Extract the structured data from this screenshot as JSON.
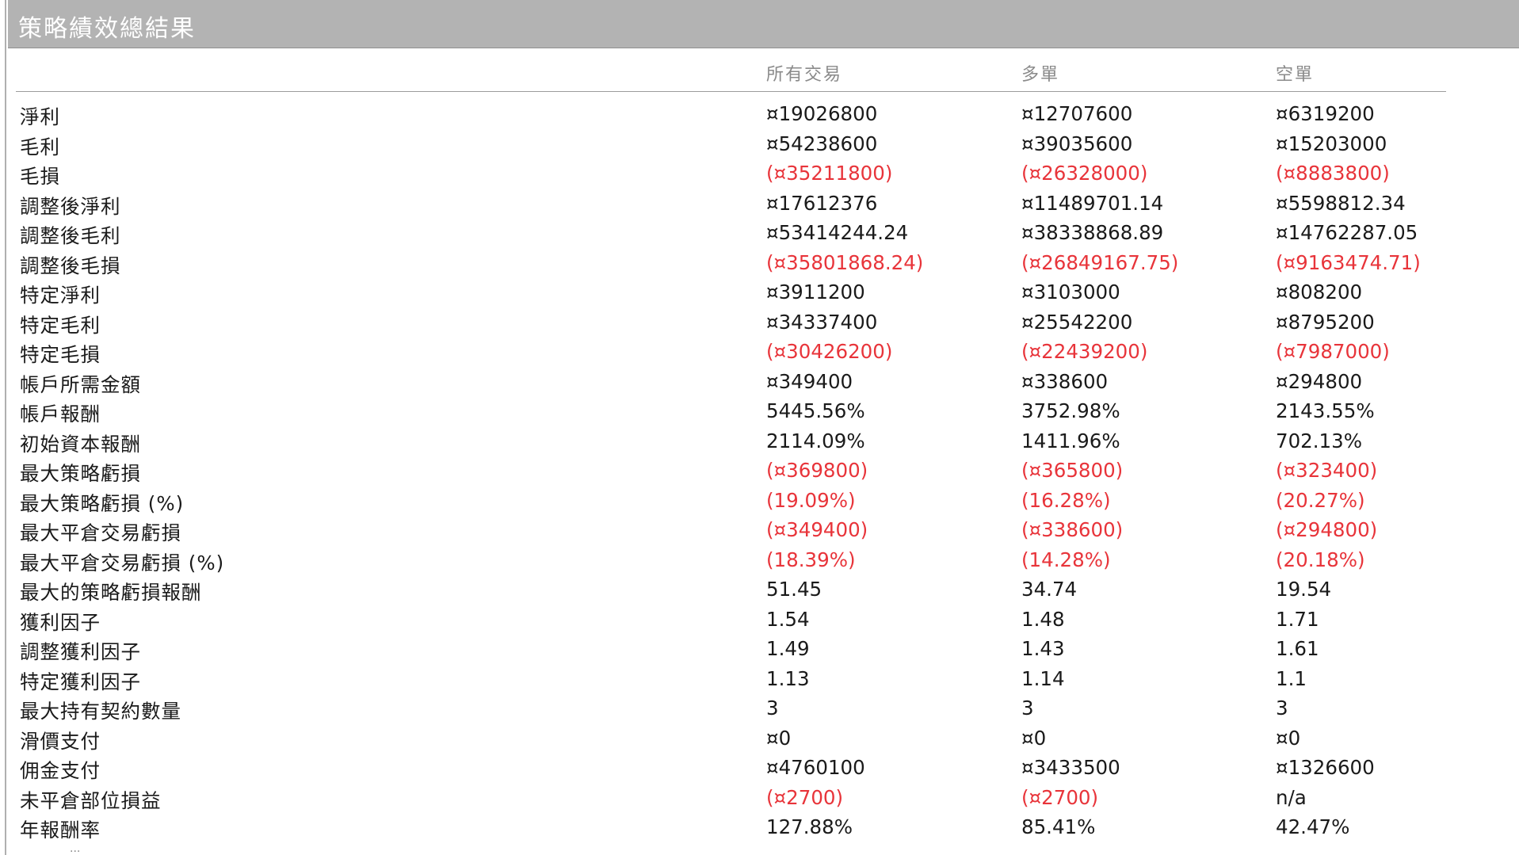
{
  "title": "策略績效總結果",
  "columns": [
    "所有交易",
    "多單",
    "空單"
  ],
  "colors": {
    "negative": "#e8343a",
    "header_bar": "#b3b3b3",
    "text": "#1a1a1a"
  },
  "rows": [
    {
      "label": "淨利",
      "values": [
        "¤19026800",
        "¤12707600",
        "¤6319200"
      ],
      "neg": [
        false,
        false,
        false
      ]
    },
    {
      "label": "毛利",
      "values": [
        "¤54238600",
        "¤39035600",
        "¤15203000"
      ],
      "neg": [
        false,
        false,
        false
      ]
    },
    {
      "label": "毛損",
      "values": [
        "(¤35211800)",
        "(¤26328000)",
        "(¤8883800)"
      ],
      "neg": [
        true,
        true,
        true
      ]
    },
    {
      "label": "調整後淨利",
      "values": [
        "¤17612376",
        "¤11489701.14",
        "¤5598812.34"
      ],
      "neg": [
        false,
        false,
        false
      ]
    },
    {
      "label": "調整後毛利",
      "values": [
        "¤53414244.24",
        "¤38338868.89",
        "¤14762287.05"
      ],
      "neg": [
        false,
        false,
        false
      ]
    },
    {
      "label": "調整後毛損",
      "values": [
        "(¤35801868.24)",
        "(¤26849167.75)",
        "(¤9163474.71)"
      ],
      "neg": [
        true,
        true,
        true
      ]
    },
    {
      "label": "特定淨利",
      "values": [
        "¤3911200",
        "¤3103000",
        "¤808200"
      ],
      "neg": [
        false,
        false,
        false
      ]
    },
    {
      "label": "特定毛利",
      "values": [
        "¤34337400",
        "¤25542200",
        "¤8795200"
      ],
      "neg": [
        false,
        false,
        false
      ]
    },
    {
      "label": "特定毛損",
      "values": [
        "(¤30426200)",
        "(¤22439200)",
        "(¤7987000)"
      ],
      "neg": [
        true,
        true,
        true
      ]
    },
    {
      "label": "帳戶所需金額",
      "values": [
        "¤349400",
        "¤338600",
        "¤294800"
      ],
      "neg": [
        false,
        false,
        false
      ]
    },
    {
      "label": "帳戶報酬",
      "values": [
        "5445.56%",
        "3752.98%",
        "2143.55%"
      ],
      "neg": [
        false,
        false,
        false
      ]
    },
    {
      "label": "初始資本報酬",
      "values": [
        "2114.09%",
        "1411.96%",
        "702.13%"
      ],
      "neg": [
        false,
        false,
        false
      ]
    },
    {
      "label": "最大策略虧損",
      "values": [
        "(¤369800)",
        "(¤365800)",
        "(¤323400)"
      ],
      "neg": [
        true,
        true,
        true
      ]
    },
    {
      "label": "最大策略虧損 (%)",
      "values": [
        "(19.09%)",
        "(16.28%)",
        "(20.27%)"
      ],
      "neg": [
        true,
        true,
        true
      ]
    },
    {
      "label": "最大平倉交易虧損",
      "values": [
        "(¤349400)",
        "(¤338600)",
        "(¤294800)"
      ],
      "neg": [
        true,
        true,
        true
      ]
    },
    {
      "label": "最大平倉交易虧損 (%)",
      "values": [
        "(18.39%)",
        "(14.28%)",
        "(20.18%)"
      ],
      "neg": [
        true,
        true,
        true
      ]
    },
    {
      "label": "最大的策略虧損報酬",
      "values": [
        "51.45",
        "34.74",
        "19.54"
      ],
      "neg": [
        false,
        false,
        false
      ]
    },
    {
      "label": "獲利因子",
      "values": [
        "1.54",
        "1.48",
        "1.71"
      ],
      "neg": [
        false,
        false,
        false
      ]
    },
    {
      "label": "調整獲利因子",
      "values": [
        "1.49",
        "1.43",
        "1.61"
      ],
      "neg": [
        false,
        false,
        false
      ]
    },
    {
      "label": "特定獲利因子",
      "values": [
        "1.13",
        "1.14",
        "1.1"
      ],
      "neg": [
        false,
        false,
        false
      ]
    },
    {
      "label": "最大持有契約數量",
      "values": [
        "3",
        "3",
        "3"
      ],
      "neg": [
        false,
        false,
        false
      ]
    },
    {
      "label": "滑價支付",
      "values": [
        "¤0",
        "¤0",
        "¤0"
      ],
      "neg": [
        false,
        false,
        false
      ]
    },
    {
      "label": "佣金支付",
      "values": [
        "¤4760100",
        "¤3433500",
        "¤1326600"
      ],
      "neg": [
        false,
        false,
        false
      ]
    },
    {
      "label": "未平倉部位損益",
      "values": [
        "(¤2700)",
        "(¤2700)",
        "n/a"
      ],
      "neg": [
        true,
        true,
        false
      ]
    },
    {
      "label": "年報酬率",
      "values": [
        "127.88%",
        "85.41%",
        "42.47%"
      ],
      "neg": [
        false,
        false,
        false
      ]
    }
  ],
  "footer_ellipsis": "..."
}
